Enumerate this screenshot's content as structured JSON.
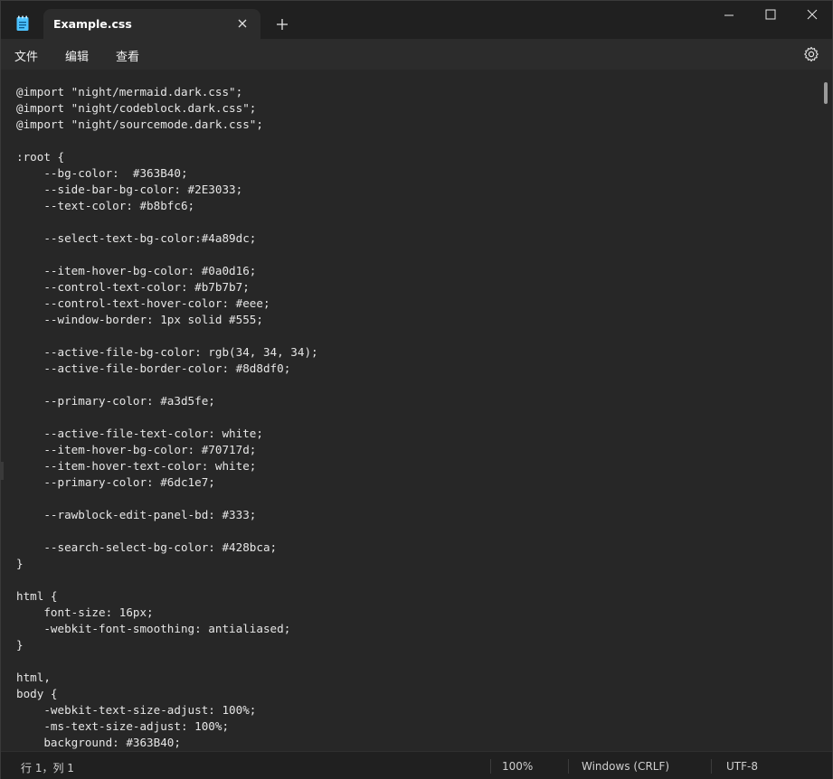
{
  "tab": {
    "title": "Example.css"
  },
  "menu": {
    "file": "文件",
    "edit": "编辑",
    "view": "查看"
  },
  "editor": {
    "lines": [
      "@import \"night/mermaid.dark.css\";",
      "@import \"night/codeblock.dark.css\";",
      "@import \"night/sourcemode.dark.css\";",
      "",
      ":root {",
      "    --bg-color:  #363B40;",
      "    --side-bar-bg-color: #2E3033;",
      "    --text-color: #b8bfc6;",
      "",
      "    --select-text-bg-color:#4a89dc;",
      "",
      "    --item-hover-bg-color: #0a0d16;",
      "    --control-text-color: #b7b7b7;",
      "    --control-text-hover-color: #eee;",
      "    --window-border: 1px solid #555;",
      "",
      "    --active-file-bg-color: rgb(34, 34, 34);",
      "    --active-file-border-color: #8d8df0;",
      "",
      "    --primary-color: #a3d5fe;",
      "",
      "    --active-file-text-color: white;",
      "    --item-hover-bg-color: #70717d;",
      "    --item-hover-text-color: white;",
      "    --primary-color: #6dc1e7;",
      "",
      "    --rawblock-edit-panel-bd: #333;",
      "",
      "    --search-select-bg-color: #428bca;",
      "}",
      "",
      "html {",
      "    font-size: 16px;",
      "    -webkit-font-smoothing: antialiased;",
      "}",
      "",
      "html,",
      "body {",
      "    -webkit-text-size-adjust: 100%;",
      "    -ms-text-size-adjust: 100%;",
      "    background: #363B40;"
    ]
  },
  "status": {
    "position": "行 1，列 1",
    "zoom": "100%",
    "line_ending": "Windows (CRLF)",
    "encoding": "UTF-8"
  },
  "colors": {
    "titlebar": "#202020",
    "tab_active": "#2c2c2c",
    "editor_bg": "#272727",
    "text": "#e6e6e6",
    "app_icon": "#4cc2ff"
  }
}
